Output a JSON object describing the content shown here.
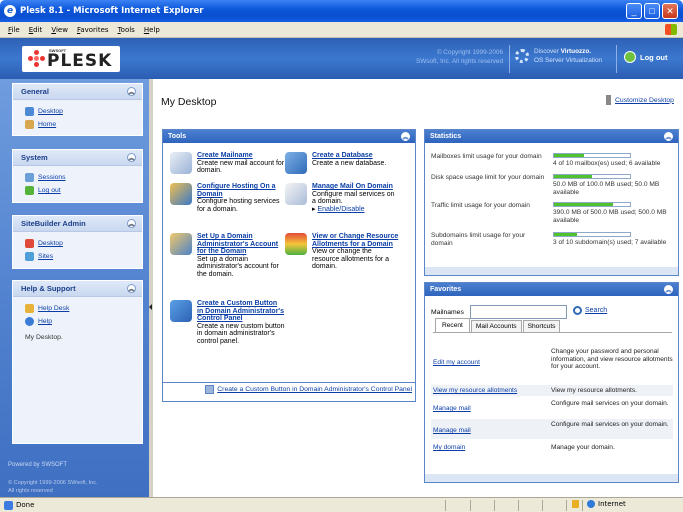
{
  "window": {
    "title": "Plesk 8.1 - Microsoft Internet Explorer",
    "minimize": "_",
    "maximize": "□",
    "close": "✕"
  },
  "menu": [
    "File",
    "Edit",
    "View",
    "Favorites",
    "Tools",
    "Help"
  ],
  "header": {
    "logo_brand": "SWSOFT",
    "logo_name": "PLESK",
    "copyright_line1": "© Copyright 1999-2006",
    "copyright_line2": "SWsoft, Inc. All rights reserved",
    "discover_prefix": "Discover ",
    "discover_bold": "Virtuozzo.",
    "discover_line2": "OS Server Virtualization",
    "logout": "Log out"
  },
  "nav": {
    "general": {
      "title": "General",
      "items": [
        "Desktop",
        "Home"
      ]
    },
    "system": {
      "title": "System",
      "items": [
        "Sessions",
        "Log out"
      ]
    },
    "sitebuilder": {
      "title": "SiteBuilder Admin",
      "items": [
        "Desktop",
        "Sites"
      ]
    },
    "help": {
      "title": "Help & Support",
      "items": [
        "Help Desk",
        "Help"
      ],
      "context": "My Desktop."
    },
    "powered_by": "Powered by SWSOFT",
    "copyright_line1": "© Copyright 1999-2006 SWsoft, Inc.",
    "copyright_line2": "All rights reserved"
  },
  "main": {
    "title": "My Desktop",
    "customize": "Customize Desktop"
  },
  "tools": {
    "title": "Tools",
    "items": [
      {
        "link": "Create Mailname",
        "desc": "Create new mail account for domain."
      },
      {
        "link": "Create a Database",
        "desc": "Create a new database."
      },
      {
        "link": "Configure Hosting On a Domain",
        "desc": "Configure hosting services for a domain."
      },
      {
        "link": "Manage Mail On Domain",
        "desc": "Configure mail services on a domain.",
        "sub": "Enable/Disable"
      },
      {
        "link": "Set Up a Domain Administrator's Account for the Domain",
        "desc": "Set up a domain administrator's account for the domain."
      },
      {
        "link": "View or Change Resource Allotments for a Domain",
        "desc": "View or change the resource allotments for a domain."
      },
      {
        "link": "Create a Custom Button in Domain Administrator's Control Panel",
        "desc": "Create a new custom button in domain administrator's control panel."
      }
    ],
    "footer_link": "Create a Custom Button in Domain Administrator's Control Panel"
  },
  "statistics": {
    "title": "Statistics",
    "rows": [
      {
        "label": "Mailboxes limit usage for your domain",
        "value": "4 of 10 mailbox(es) used; 6 available",
        "fraction": 0.4
      },
      {
        "label": "Disk space usage limit for your domain",
        "value": "50.0 MB of 100.0 MB used; 50.0 MB available",
        "fraction": 0.5
      },
      {
        "label": "Traffic limit usage for your domain",
        "value": "390.0 MB of 500.0 MB used; 500.0 MB available",
        "fraction": 0.78
      },
      {
        "label": "Subdomains limit usage for your domain",
        "value": "3 of 10 subdomain(s) used; 7 available",
        "fraction": 0.3
      }
    ]
  },
  "favorites": {
    "title": "Favorites",
    "search_label": "Mailnames",
    "search_value": "",
    "search_button": "Search",
    "tabs": [
      "Recent",
      "Mail Accounts",
      "Shortcuts"
    ],
    "active_tab": "Recent",
    "rows": [
      {
        "link": "Edit my account",
        "desc": "Change your password and personal information, and view resource allotments for your account."
      },
      {
        "link": "View my resource allotments",
        "desc": "View my resource allotments."
      },
      {
        "link": "Manage mail",
        "desc": "Configure mail services on your domain."
      },
      {
        "link": "Manage mail",
        "desc": "Configure mail services on your domain."
      },
      {
        "link": "My domain",
        "desc": "Manage your domain."
      }
    ]
  },
  "statusbar": {
    "status": "Done",
    "zone": "Internet"
  },
  "colors": {
    "header_blue": "#3c78cf",
    "panel_blue": "#2e64bd",
    "usage_green": "#50c22e",
    "link": "#0a3ea6"
  }
}
